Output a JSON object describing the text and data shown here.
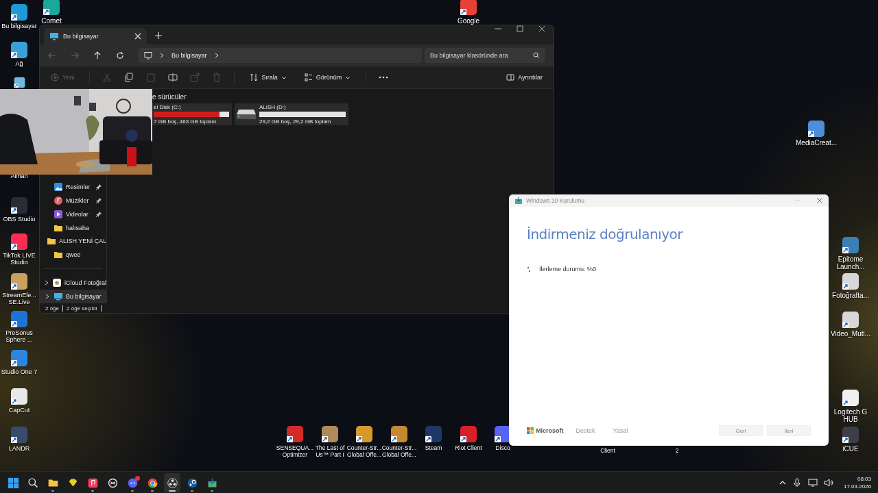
{
  "desktop": {
    "left_icons": [
      {
        "label": "Bu bilgisayar",
        "kind": "tile",
        "color": "#1e9ad6"
      },
      {
        "label": "Ağ",
        "kind": "tile",
        "color": "#3aa0d8"
      },
      {
        "kind": "icon_only",
        "color": "#6fb8e0"
      },
      {
        "label": "Alihan",
        "kind": "label_only"
      },
      {
        "label": "OBS Studio",
        "kind": "tile",
        "color": "#2a2d33"
      },
      {
        "label": "TikTok LIVE Studio",
        "kind": "tile",
        "color": "#fe2c55"
      },
      {
        "label": "StreamEle... SE.Live",
        "kind": "tile",
        "color": "#c9a060"
      },
      {
        "label": "PreSonus Sphere ...",
        "kind": "tile",
        "color": "#1e73d6"
      },
      {
        "label": "Studio One 7",
        "kind": "tile",
        "color": "#2a86e0"
      },
      {
        "label": "CapCut",
        "kind": "tile",
        "color": "#e8e8e8"
      },
      {
        "label": "LANDR",
        "kind": "tile",
        "color": "#3a4a6a"
      }
    ],
    "top_icons": [
      {
        "label": "Comet",
        "kind": "tile",
        "color": "#1aa89a"
      },
      {
        "label": "Google",
        "kind": "tile",
        "color": "#e94235"
      }
    ],
    "right_icons": [
      {
        "label": "MediaCreat...",
        "kind": "tile",
        "color": "#4f8fd8"
      },
      {
        "label": "Epitome Launch...",
        "kind": "tile",
        "color": "#3a7fb8"
      },
      {
        "label": "Fotoğrafta...",
        "kind": "tile",
        "color": "#d8d8d8"
      },
      {
        "label": "Video_Mutl...",
        "kind": "tile",
        "color": "#d8d8d8"
      },
      {
        "label": "Logitech G HUB",
        "kind": "tile",
        "color": "#f0f0f0"
      },
      {
        "label": "iCUE",
        "kind": "tile",
        "color": "#3b3f48"
      }
    ],
    "bottom_icons": [
      {
        "label": "SENSEQUA... Optimizer",
        "kind": "tile",
        "color": "#d42a2a"
      },
      {
        "label": "The Last of Us™ Part I",
        "kind": "tile",
        "color": "#b08a5a"
      },
      {
        "label": "Counter-Str... Global Offe...",
        "kind": "tile",
        "color": "#d69a2a"
      },
      {
        "label": "Counter-Str... Global Offe...",
        "kind": "tile",
        "color": "#c8892e"
      },
      {
        "label": "Steam",
        "kind": "tile",
        "color": "#1b3a66"
      },
      {
        "label": "Riot Client",
        "kind": "tile",
        "color": "#d8202a"
      },
      {
        "label": "Disco",
        "kind": "tile",
        "color": "#5865f2"
      },
      {
        "label": "Client",
        "kind": "label_only"
      },
      {
        "label": "2",
        "kind": "label_only"
      }
    ]
  },
  "explorer": {
    "tab": {
      "title": "Bu bilgisayar",
      "selected": true
    },
    "breadcrumb": "Bu bilgisayar",
    "search": {
      "placeholder": "Bu bilgisayar klasöründe ara"
    },
    "toolbar": {
      "new": {
        "label": "Yeni",
        "disabled": true
      },
      "sort": "Sırala",
      "view": "Görünüm",
      "details": "Ayrıntılar"
    },
    "sidebar": [
      {
        "label": "Resimler",
        "kind": "pictures",
        "pinned": true,
        "selected": false
      },
      {
        "label": "Müzikler",
        "kind": "music",
        "pinned": true,
        "selected": false
      },
      {
        "label": "Videolar",
        "kind": "videos",
        "pinned": true,
        "selected": false
      },
      {
        "label": "halısaha",
        "kind": "folder",
        "pinned": false,
        "selected": false
      },
      {
        "label": "ALISH YENİ ÇAL",
        "kind": "folder",
        "pinned": false,
        "selected": false
      },
      {
        "label": "qwee",
        "kind": "folder",
        "pinned": false,
        "selected": false
      },
      {
        "label": "iCloud Fotoğraf",
        "kind": "icloud",
        "pinned": false,
        "selected": false,
        "expandable": true
      },
      {
        "label": "Bu bilgisayar",
        "kind": "pc",
        "pinned": false,
        "selected": true,
        "expandable": true
      }
    ],
    "section_title": "e sürücüler",
    "drives": [
      {
        "name": "el Disk (C:)",
        "info": "7 GB boş, 463 GB toplam",
        "level": 0.87,
        "show_icon": false
      },
      {
        "name": "ALISH (D:)",
        "info": "29,2 GB boş, 29,2 GB toplam",
        "show_icon": true
      }
    ],
    "status": [
      "2 öğe",
      "2 öğe seçildi"
    ]
  },
  "setup": {
    "title": "Windows 10 Kurulumu",
    "heading": "İndirmeniz doğrulanıyor",
    "progress": "İlerleme durumu: %0",
    "footer_brand": "Microsoft",
    "links": [
      "Destek",
      "Yasal"
    ],
    "buttons": [
      {
        "label": "Geri",
        "disabled": true
      },
      {
        "label": "İleri",
        "disabled": true
      }
    ]
  },
  "taskbar": {
    "apps": [
      {
        "kind": "start",
        "running": false,
        "active": false
      },
      {
        "kind": "search",
        "running": false,
        "active": false
      },
      {
        "kind": "folder",
        "running": true,
        "active": false
      },
      {
        "kind": "diamond",
        "running": false,
        "active": false
      },
      {
        "kind": "music",
        "running": true,
        "active": false
      },
      {
        "kind": "knot",
        "running": false,
        "active": false
      },
      {
        "kind": "discord",
        "running": true,
        "active": false,
        "badge": true
      },
      {
        "kind": "chrome",
        "running": true,
        "active": false
      },
      {
        "kind": "obs",
        "running": true,
        "active": true
      },
      {
        "kind": "steam",
        "running": true,
        "active": false
      },
      {
        "kind": "installer",
        "running": true,
        "active": false
      }
    ],
    "time": "08:03",
    "date": "17.03.2026"
  }
}
